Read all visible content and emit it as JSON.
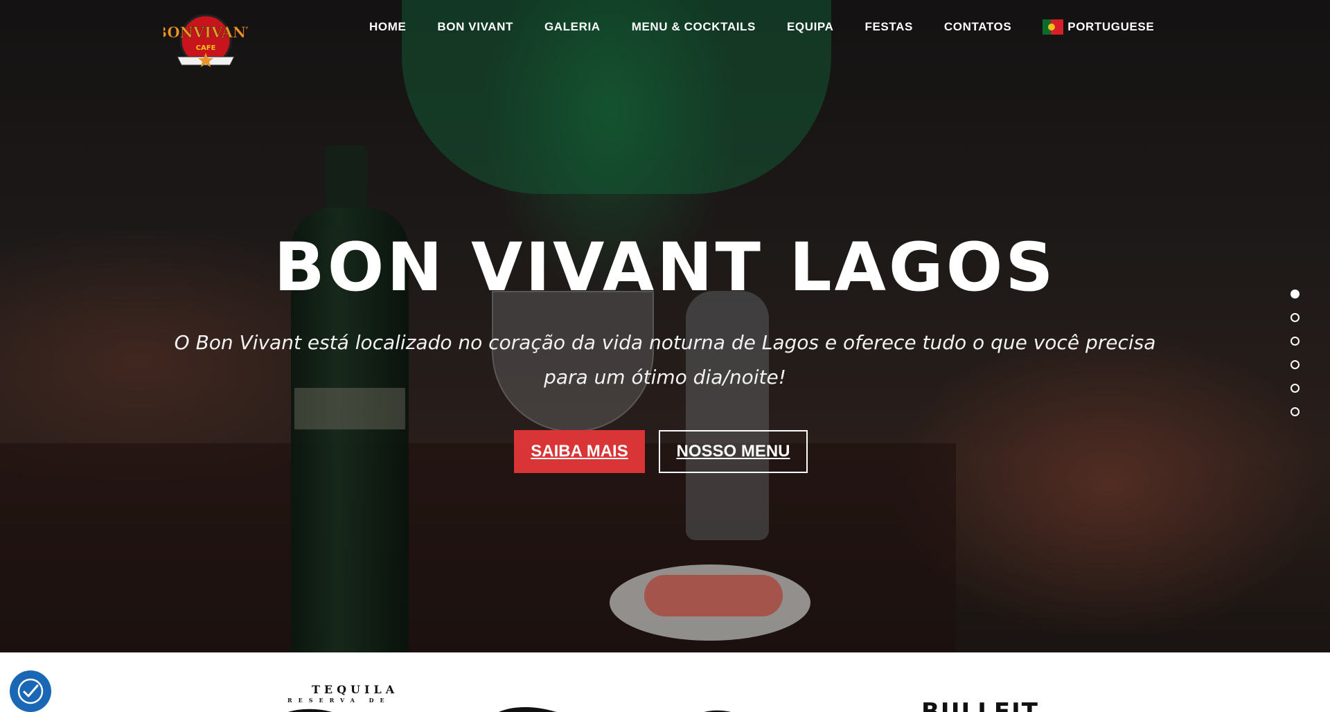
{
  "logo": {
    "text": "BONVIVANT",
    "sub": "CAFE"
  },
  "nav": {
    "items": [
      "HOME",
      "BON VIVANT",
      "GALERIA",
      "MENU & COCKTAILS",
      "EQUIPA",
      "FESTAS",
      "CONTATOS"
    ],
    "language": "PORTUGUESE"
  },
  "hero": {
    "title": "BON VIVANT LAGOS",
    "subtitle": "O Bon Vivant está localizado no coração da vida noturna de Lagos e oferece tudo o que você precisa para um ótimo dia/noite!",
    "primary_button": "SAIBA MAIS",
    "secondary_button": "NOSSO MENU",
    "slides": 6,
    "active_slide": 1
  },
  "brands": {
    "tequila": "TEQUILA",
    "reserva": "RESERVA DE",
    "bulleit": "BULLEIT"
  },
  "icons": [
    "flag-pt-icon",
    "accessibility-icon"
  ],
  "colors": {
    "accent": "#d93436",
    "accessibility": "#1967b5"
  }
}
